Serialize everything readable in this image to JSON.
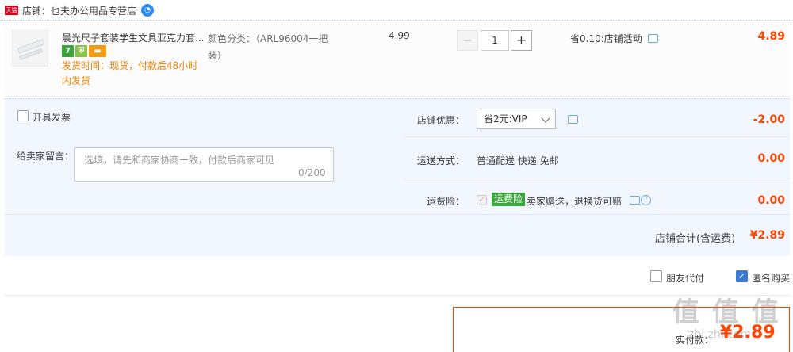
{
  "shop": {
    "badge": "天猫",
    "name": "店铺：也夫办公用品专营店",
    "ww_icon": "chat-bubble-icon"
  },
  "item": {
    "title": "晨光尺子套装学生文具亚克力套...",
    "badges": [
      "7",
      "shield",
      "card"
    ],
    "ship_time": "发货时间：现货，付款后48小时内发货",
    "sku": "颜色分类：（ARL96004一把装）",
    "price": "4.99",
    "qty_minus": "−",
    "qty": "1",
    "qty_plus": "+",
    "promo": "省0.10:店铺活动",
    "subtotal": "4.89"
  },
  "options": {
    "invoice_label": "开具发票",
    "message_label": "给卖家留言：",
    "message_placeholder": "选填，请先和商家协商一致，付款后商家可见",
    "message_count": "0/200",
    "discount_label": "店铺优惠：",
    "discount_selected": "省2元:VIP",
    "discount_value": "-2.00",
    "shipping_label": "运送方式：",
    "shipping_value": "普通配送 快递 免邮",
    "shipping_cost": "0.00",
    "insurance_label": "运费险：",
    "insurance_tag": "运费险",
    "insurance_text": "卖家赠送，退换货可赔",
    "insurance_cost": "0.00",
    "shop_total_label": "店铺合计(含运费)",
    "shop_total_value": "¥2.89"
  },
  "checkout": {
    "friend_pay_label": "朋友代付",
    "friend_pay_checked": false,
    "anonymous_label": "匿名购买",
    "anonymous_checked": true,
    "pay_label": "实付款：",
    "pay_value": "¥2.89"
  },
  "watermark": {
    "main": "值 值 值",
    "sub": "zhi.zhi.com"
  },
  "colors": {
    "accent": "#ff4400",
    "panel_bg": "#f2f7ff",
    "link_blue": "#3b7bd6",
    "ship_orange": "#f08200"
  }
}
